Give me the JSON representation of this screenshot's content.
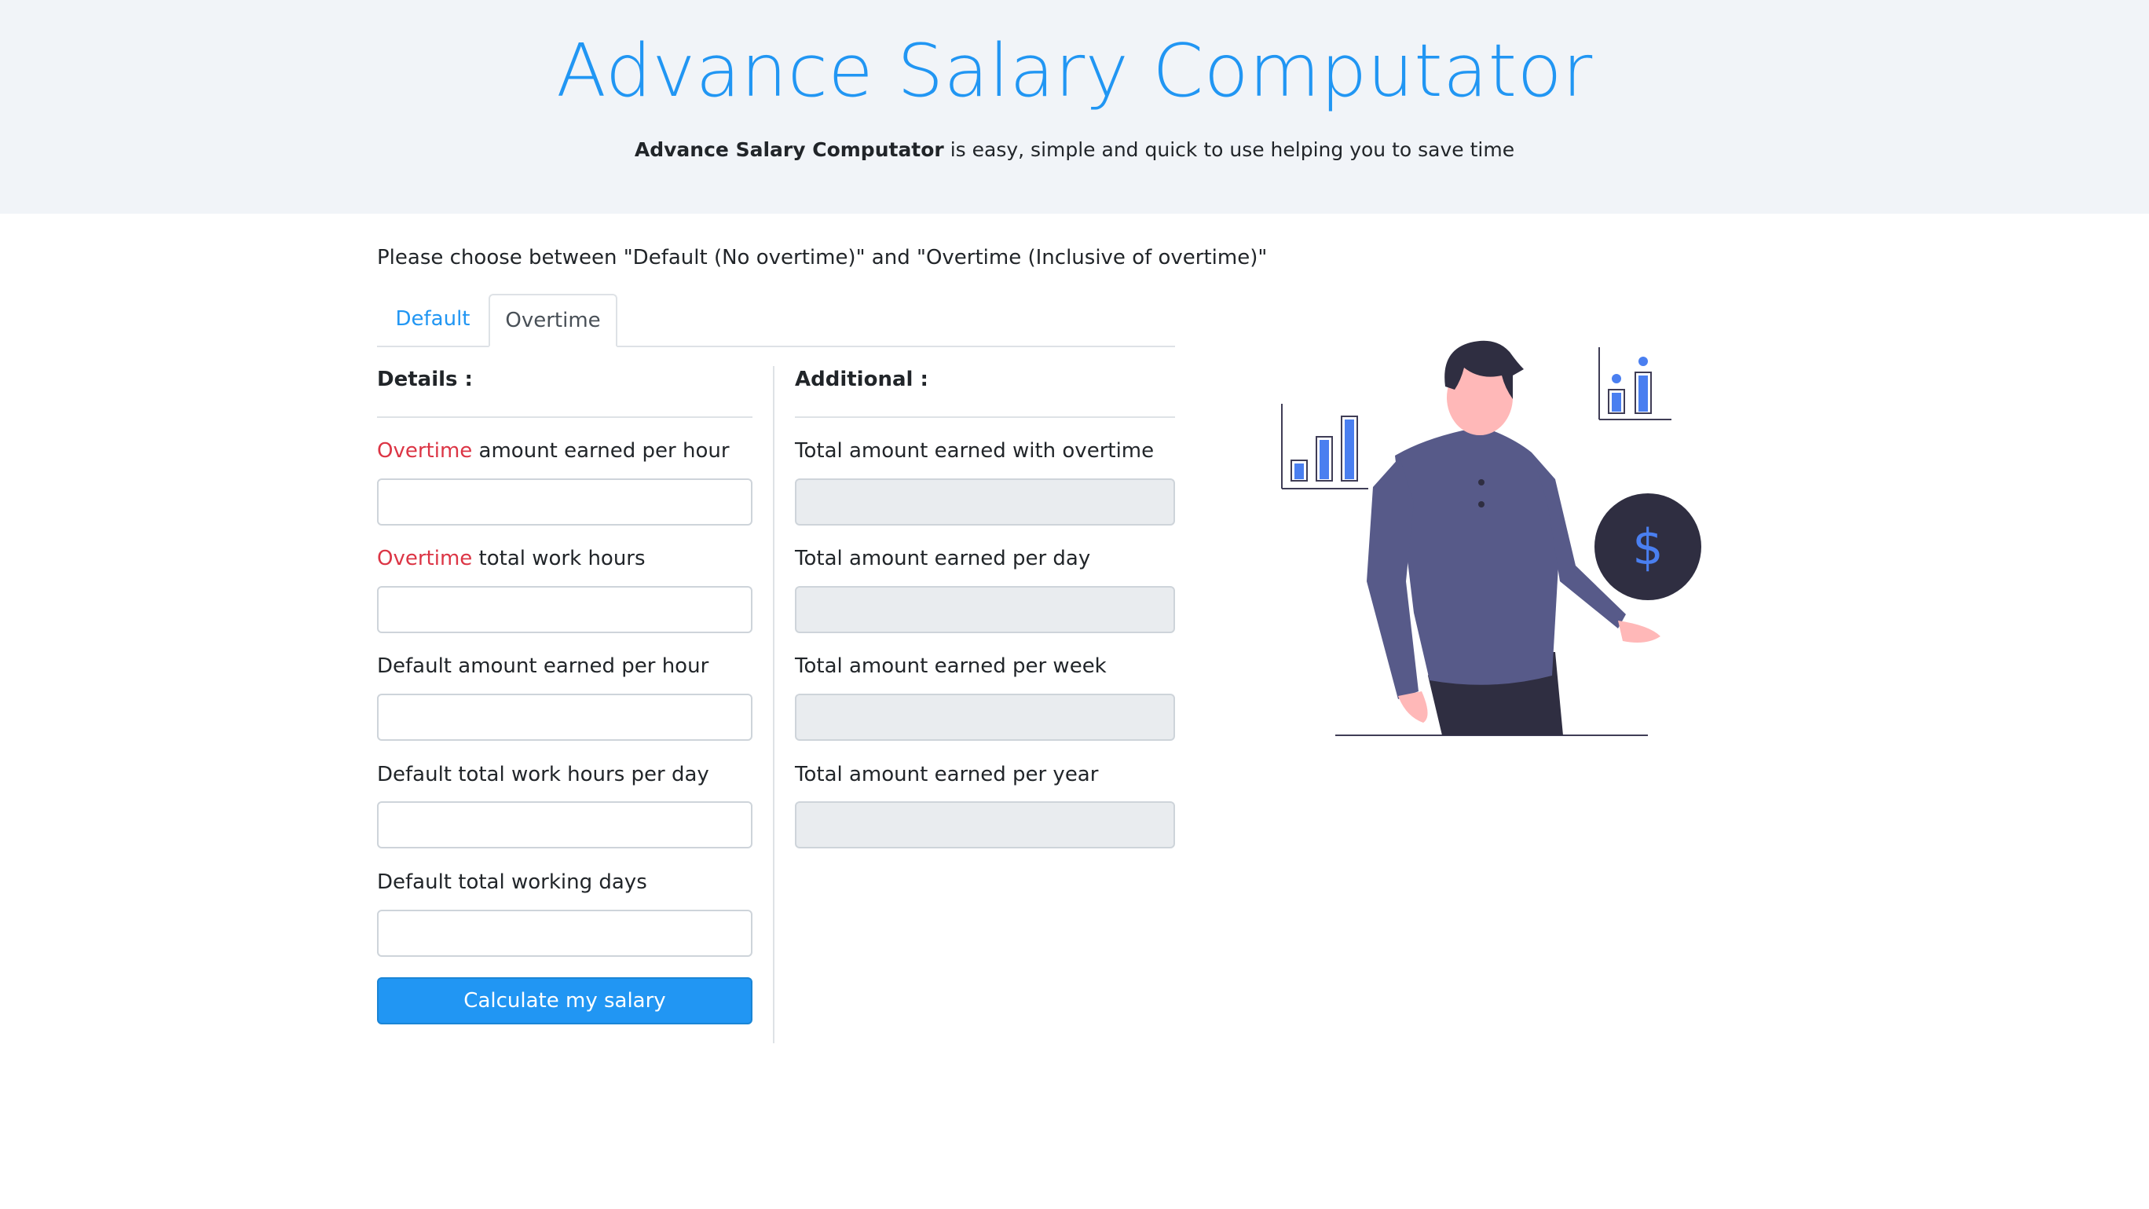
{
  "hero": {
    "title": "Advance Salary Computator",
    "subtitle_bold": "Advance Salary Computator",
    "subtitle_rest": " is easy, simple and quick to use helping you to save time"
  },
  "instruction": "Please choose between \"Default (No overtime)\" and \"Overtime (Inclusive of overtime)\"",
  "tabs": [
    {
      "label": "Default",
      "active": false
    },
    {
      "label": "Overtime",
      "active": true
    }
  ],
  "details": {
    "heading": "Details :",
    "fields": [
      {
        "accent": "Overtime",
        "label": " amount earned per hour",
        "value": ""
      },
      {
        "accent": "Overtime",
        "label": " total work hours",
        "value": ""
      },
      {
        "accent": "",
        "label": "Default amount earned per hour",
        "value": ""
      },
      {
        "accent": "",
        "label": "Default total work hours per day",
        "value": ""
      },
      {
        "accent": "",
        "label": "Default total working days",
        "value": ""
      }
    ],
    "button": "Calculate my salary"
  },
  "additional": {
    "heading": "Additional :",
    "fields": [
      {
        "label": "Total amount earned with overtime",
        "value": ""
      },
      {
        "label": "Total amount earned per day",
        "value": ""
      },
      {
        "label": "Total amount earned per week",
        "value": ""
      },
      {
        "label": "Total amount earned per year",
        "value": ""
      }
    ]
  },
  "illustration": {
    "coin_symbol": "$",
    "icons": [
      "person-illustration",
      "bar-chart-icon",
      "dollar-coin-icon"
    ]
  },
  "colors": {
    "accent": "#2196f3",
    "overtime_red": "#dc3545",
    "hero_bg": "#f1f4f8",
    "shirt": "#575a89",
    "coin": "#2f2e41"
  }
}
